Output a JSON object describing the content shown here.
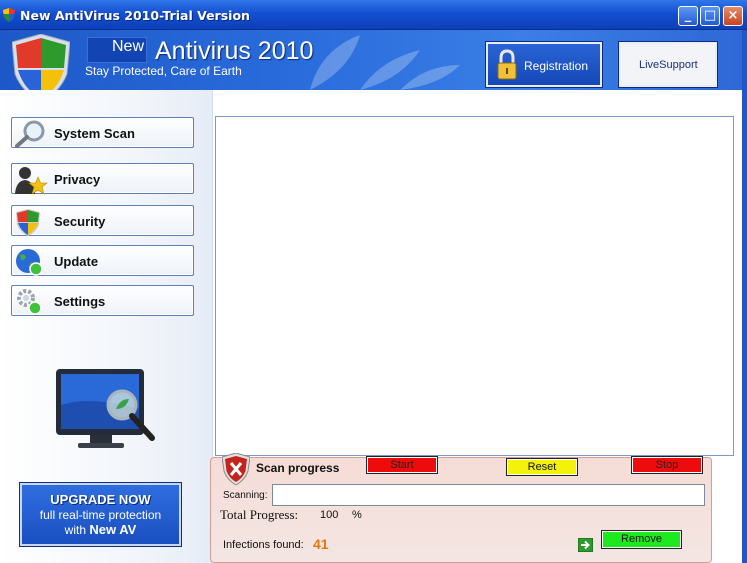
{
  "window": {
    "title": "New AntiVirus 2010-Trial Version",
    "controls": {
      "minimize": "_",
      "maximize": "□",
      "close": "×"
    }
  },
  "header": {
    "brand_prefix": "New",
    "brand_name": "Antivirus 2010",
    "tagline": "Stay Protected, Care of Earth",
    "registration_label": "Registration",
    "livesupport_label": "LiveSupport"
  },
  "sidebar": {
    "items": [
      {
        "label": "System Scan",
        "icon": "magnifier-icon"
      },
      {
        "label": "Privacy",
        "icon": "person-star-icon"
      },
      {
        "label": "Security",
        "icon": "shield-icon"
      },
      {
        "label": "Update",
        "icon": "globe-icon"
      },
      {
        "label": "Settings",
        "icon": "gear-icon"
      }
    ],
    "upgrade": {
      "line1": "UPGRADE NOW",
      "line2": "full real-time protection",
      "line3_prefix": "with",
      "line3_brand": "New AV"
    }
  },
  "scan": {
    "title": "Scan progress",
    "start_label": "Start",
    "reset_label": "Reset",
    "stop_label": "Stop",
    "scanning_label": "Scanning:",
    "scanning_value": "",
    "total_label": "Total Progress:",
    "total_value": "100",
    "total_unit": "%",
    "infections_label": "Infections found:",
    "infections_value": "41",
    "remove_label": "Remove"
  },
  "colors": {
    "titlebar": "#1450d2",
    "header": "#2a6cdc",
    "start_button": "#ee0b0b",
    "reset_button": "#f4f20a",
    "stop_button": "#ee0b0b",
    "remove_button": "#1ee81e",
    "infections_count": "#e07a10",
    "scan_panel": "#f6dcd6"
  }
}
